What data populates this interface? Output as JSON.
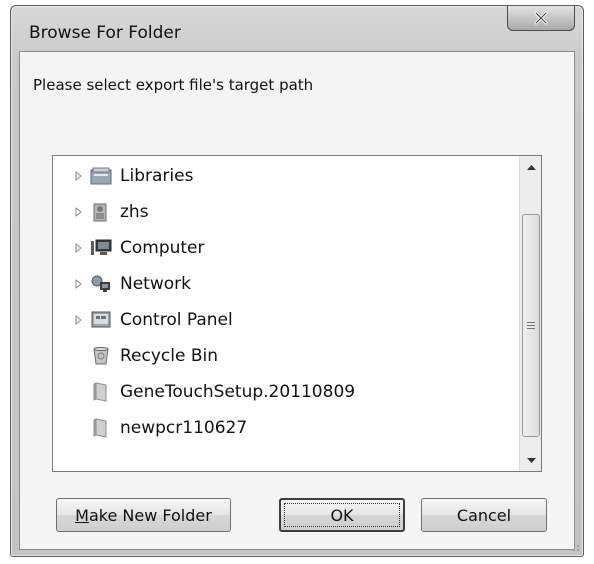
{
  "window": {
    "title": "Browse For Folder",
    "close_icon": "close-x-icon"
  },
  "prompt": "Please select export file's target path",
  "tree": {
    "items": [
      {
        "label": "Libraries",
        "icon": "libraries-icon",
        "expandable": true
      },
      {
        "label": "zhs",
        "icon": "user-folder-icon",
        "expandable": true
      },
      {
        "label": "Computer",
        "icon": "computer-icon",
        "expandable": true
      },
      {
        "label": "Network",
        "icon": "network-icon",
        "expandable": true
      },
      {
        "label": "Control Panel",
        "icon": "control-panel-icon",
        "expandable": true
      },
      {
        "label": "Recycle Bin",
        "icon": "recycle-bin-icon",
        "expandable": false
      },
      {
        "label": "GeneTouchSetup.20110809",
        "icon": "folder-icon",
        "expandable": false
      },
      {
        "label": "newpcr110627",
        "icon": "folder-icon",
        "expandable": false
      }
    ]
  },
  "buttons": {
    "make_new_folder_first": "M",
    "make_new_folder_rest": "ake New Folder",
    "ok": "OK",
    "cancel": "Cancel"
  }
}
